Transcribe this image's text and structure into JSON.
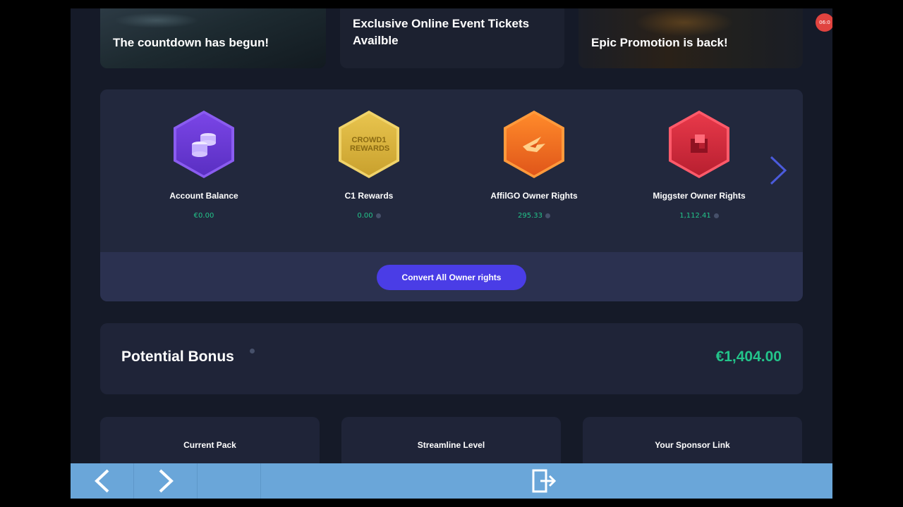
{
  "banners": [
    {
      "text": "The countdown has begun!"
    },
    {
      "text": "Exclusive Online Event Tickets Availble"
    },
    {
      "text": "Epic Promotion is back!"
    }
  ],
  "notification": {
    "text": "06:0"
  },
  "wallet": {
    "items": [
      {
        "label": "Account Balance",
        "value": "€0.00",
        "icon": "coins-icon",
        "color": "#6b3fd9"
      },
      {
        "label": "C1 Rewards",
        "value": "0.00",
        "icon": "crowd1-rewards-icon",
        "color": "#e2b93b",
        "badge_text": "CROWD1 REWARDS"
      },
      {
        "label": "AffilGO Owner Rights",
        "value": "295.33",
        "icon": "affilgo-icon",
        "color": "#f06a21"
      },
      {
        "label": "Miggster Owner Rights",
        "value": "1,112.41",
        "icon": "miggster-icon",
        "color": "#d62b3d"
      }
    ],
    "convert_button": "Convert All Owner rights"
  },
  "bonus": {
    "title": "Potential Bonus",
    "value": "€1,404.00"
  },
  "cards": [
    {
      "label": "Current Pack"
    },
    {
      "label": "Streamline Level"
    },
    {
      "label": "Your Sponsor Link"
    }
  ],
  "colors": {
    "accent": "#4a3de6",
    "positive": "#23c48a",
    "background": "#151a28",
    "toolbar": "#6aa6d9"
  }
}
